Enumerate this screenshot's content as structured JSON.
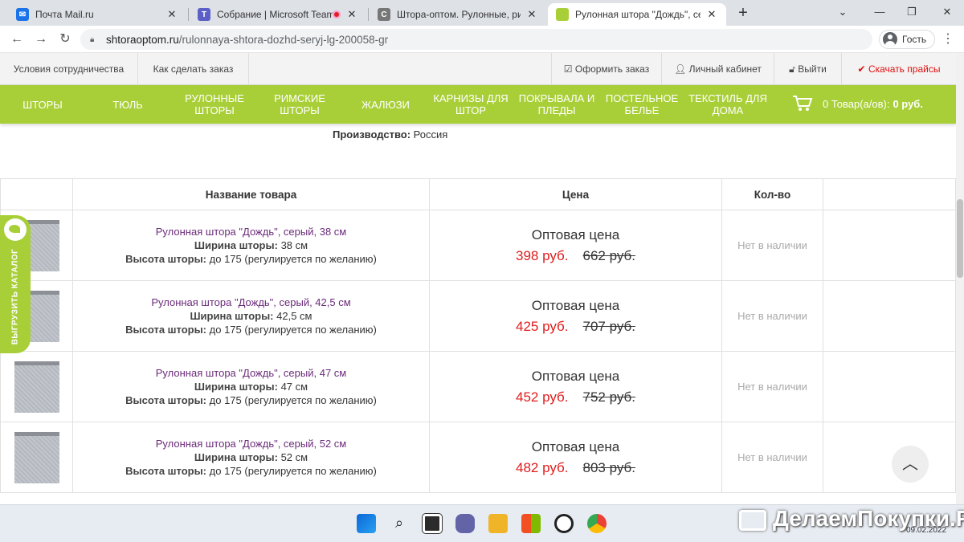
{
  "browser": {
    "tabs": [
      {
        "title": "Почта Mail.ru",
        "color": "#1a73e8"
      },
      {
        "title": "Собрание | Microsoft Teams",
        "color": "#5b5fc7"
      },
      {
        "title": "Штора-оптом. Рулонные, римск",
        "color": "#777777"
      },
      {
        "title": "Рулонная штора \"Дождь\", серы",
        "color": "#a9cf38"
      }
    ],
    "url_host": "shtoraoptom.ru",
    "url_path": "/rulonnaya-shtora-dozhd-seryj-lg-200058-gr",
    "profile_label": "Гость"
  },
  "site": {
    "top_links": [
      "Условия сотрудничества",
      "Как сделать заказ",
      "Оформить заказ",
      "Личный кабинет",
      "Выйти",
      "Скачать прайсы"
    ],
    "menu": [
      "ШТОРЫ",
      "ТЮЛЬ",
      "РУЛОННЫЕ ШТОРЫ",
      "РИМСКИЕ ШТОРЫ",
      "ЖАЛЮЗИ",
      "КАРНИЗЫ ДЛЯ ШТОР",
      "ПОКРЫВАЛА И ПЛЕДЫ",
      "ПОСТЕЛЬНОЕ БЕЛЬЕ",
      "ТЕКСТИЛЬ ДЛЯ ДОМА"
    ],
    "cart_text": "0 Товар(а/ов):",
    "cart_sum": "0 руб.",
    "production_label": "Производство:",
    "production_value": "Россия",
    "side_tab": "ВЫГРУЗИТЬ КАТАЛОГ"
  },
  "table": {
    "headers": [
      "Название товара",
      "Цена",
      "Кол-во"
    ],
    "width_label": "Ширина шторы:",
    "height_label": "Высота шторы:",
    "height_value": "до 175 (регулируется по желанию)",
    "price_title": "Оптовая цена",
    "rows": [
      {
        "name": "Рулонная штора \"Дождь\", серый, 38 см",
        "width": "38 см",
        "price": "398 руб.",
        "old_price": "662 руб.",
        "stock": "Нет в наличии"
      },
      {
        "name": "Рулонная штора \"Дождь\", серый, 42,5 см",
        "width": "42,5 см",
        "price": "425 руб.",
        "old_price": "707 руб.",
        "stock": "Нет в наличии"
      },
      {
        "name": "Рулонная штора \"Дождь\", серый, 47 см",
        "width": "47 см",
        "price": "452 руб.",
        "old_price": "752 руб.",
        "stock": "Нет в наличии"
      },
      {
        "name": "Рулонная штора \"Дождь\", серый, 52 см",
        "width": "52 см",
        "price": "482 руб.",
        "old_price": "803 руб.",
        "stock": "Нет в наличии"
      }
    ]
  },
  "watermark": "ДелаемПокупки.Ру",
  "date": "09.02.2022"
}
